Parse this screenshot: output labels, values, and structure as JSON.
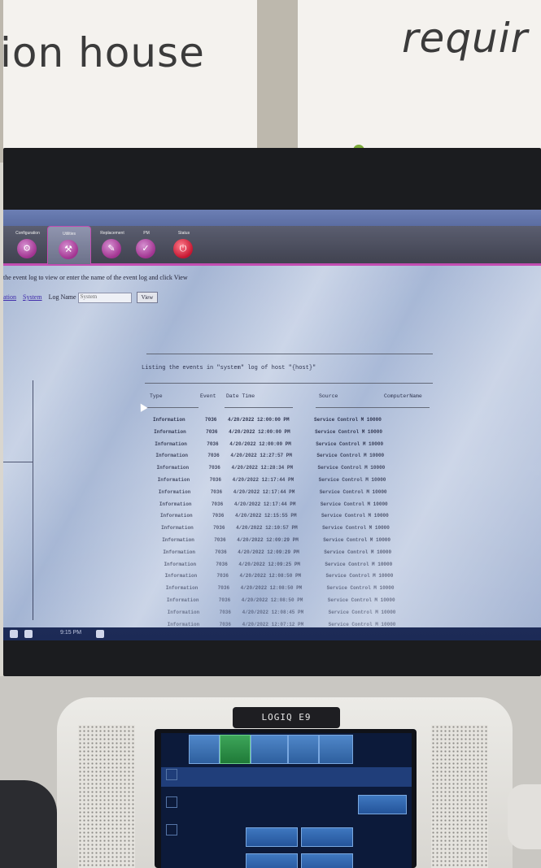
{
  "background": {
    "sign_left_text": "ion house",
    "sign_right_text": "requir"
  },
  "screen": {
    "tabs": [
      {
        "label": "Configuration",
        "icon": "gear-icon",
        "active": false
      },
      {
        "label": "Utilities",
        "icon": "tools-icon",
        "active": true
      },
      {
        "label": "Replacement",
        "icon": "wrench-icon",
        "active": false
      },
      {
        "label": "PM",
        "icon": "checklist-icon",
        "active": false
      },
      {
        "label": "Status",
        "icon": "power-icon",
        "active": false
      }
    ],
    "instruction": "the event log to view or enter the name of the event log and click View",
    "log_links": [
      "ation",
      "System"
    ],
    "log_name_label": "Log Name",
    "log_name_value": "System",
    "view_button": "View",
    "listing_title": "Listing the events in \"system\" log of host \"{host}\"",
    "columns": [
      "Type",
      "Event",
      "Date Time",
      "Source",
      "ComputerName"
    ],
    "rows": [
      {
        "type": "Information",
        "event": "7036",
        "datetime": "4/20/2022 12:00:00 PM",
        "source": "Service Control M 10000"
      },
      {
        "type": "Information",
        "event": "7036",
        "datetime": "4/20/2022 12:00:00 PM",
        "source": "Service Control M 10000"
      },
      {
        "type": "Information",
        "event": "7036",
        "datetime": "4/20/2022 12:00:00 PM",
        "source": "Service Control M 10000"
      },
      {
        "type": "Information",
        "event": "7036",
        "datetime": "4/20/2022 12:27:57 PM",
        "source": "Service Control M 10000"
      },
      {
        "type": "Information",
        "event": "7036",
        "datetime": "4/20/2022 12:28:34 PM",
        "source": "Service Control M 10000"
      },
      {
        "type": "Information",
        "event": "7036",
        "datetime": "4/20/2022 12:17:44 PM",
        "source": "Service Control M 10000"
      },
      {
        "type": "Information",
        "event": "7036",
        "datetime": "4/20/2022 12:17:44 PM",
        "source": "Service Control M 10000"
      },
      {
        "type": "Information",
        "event": "7036",
        "datetime": "4/20/2022 12:17:44 PM",
        "source": "Service Control M 10000"
      },
      {
        "type": "Information",
        "event": "7036",
        "datetime": "4/20/2022 12:15:55 PM",
        "source": "Service Control M 10000"
      },
      {
        "type": "Information",
        "event": "7036",
        "datetime": "4/20/2022 12:10:57 PM",
        "source": "Service Control M 10000"
      },
      {
        "type": "Information",
        "event": "7036",
        "datetime": "4/20/2022 12:09:29 PM",
        "source": "Service Control M 10000"
      },
      {
        "type": "Information",
        "event": "7036",
        "datetime": "4/20/2022 12:09:29 PM",
        "source": "Service Control M 10000"
      },
      {
        "type": "Information",
        "event": "7036",
        "datetime": "4/20/2022 12:09:25 PM",
        "source": "Service Control M 10000"
      },
      {
        "type": "Information",
        "event": "7036",
        "datetime": "4/20/2022 12:08:50 PM",
        "source": "Service Control M 10000"
      },
      {
        "type": "Information",
        "event": "7036",
        "datetime": "4/20/2022 12:08:50 PM",
        "source": "Service Control M 10000"
      },
      {
        "type": "Information",
        "event": "7036",
        "datetime": "4/20/2022 12:08:50 PM",
        "source": "Service Control M 10000"
      },
      {
        "type": "Information",
        "event": "7036",
        "datetime": "4/20/2022 12:08:45 PM",
        "source": "Service Control M 10000"
      },
      {
        "type": "Information",
        "event": "7036",
        "datetime": "4/20/2022 12:07:12 PM",
        "source": "Service Control M 10000"
      },
      {
        "type": "Information",
        "event": "7036",
        "datetime": "4/20/2022 12:07:12 PM",
        "source": "Service Control M 10000"
      }
    ],
    "taskbar_text": "9:15 PM"
  },
  "console": {
    "brand": "LOGIQ E9"
  }
}
